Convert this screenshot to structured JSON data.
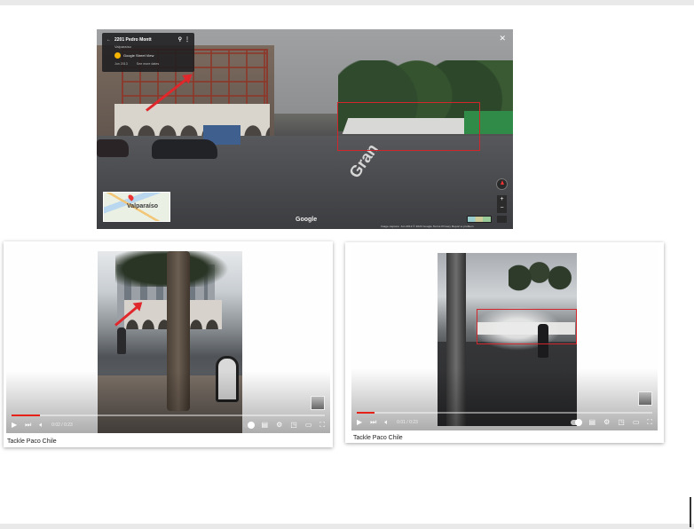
{
  "streetview": {
    "address": "2201 Pedro Montt",
    "locality": "Valparaíso",
    "source": "Google Street View",
    "date": "Jun 2013",
    "see_more": "See more dates",
    "road_marking": "Gran",
    "minimap_label": "Valparaíso",
    "watermark": "Google",
    "footer": "Image capture: Jun 2013   © 2023 Google   Terms   Privacy   Report a problem",
    "icons": {
      "back": "arrow-left-icon",
      "pin": "location-pin-icon",
      "more": "more-vert-icon",
      "close": "close-icon",
      "compass": "compass-icon",
      "zoom_in": "+",
      "zoom_out": "−"
    },
    "colors": {
      "highlight_box": "#d1262b",
      "arrow": "#e0282c"
    }
  },
  "videos": [
    {
      "caption": "Tackle Paco Chile",
      "time": "0:02 / 0:23",
      "progress": 0.09
    },
    {
      "caption": "Tackle Paco Chile",
      "time": "0:01 / 0:23",
      "progress": 0.06
    }
  ],
  "player_icons": [
    "play-icon",
    "next-icon",
    "volume-icon",
    "autoplay-toggle",
    "subtitles-icon",
    "settings-icon",
    "miniplayer-icon",
    "theater-icon",
    "fullscreen-icon"
  ],
  "colors": {
    "progress": "#e62117"
  }
}
